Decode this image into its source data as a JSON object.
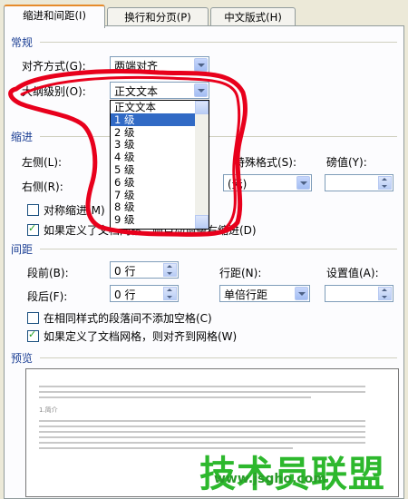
{
  "tabs": [
    {
      "label": "缩进和间距(I)",
      "active": true
    },
    {
      "label": "换行和分页(P)",
      "active": false
    },
    {
      "label": "中文版式(H)",
      "active": false
    }
  ],
  "general": {
    "heading": "常规",
    "alignment_label": "对齐方式(G):",
    "alignment_value": "两端对齐",
    "outline_label": "大纲级别(O):",
    "outline_value": "正文文本"
  },
  "outline_dropdown": {
    "items": [
      "正文文本",
      "1 级",
      "2 级",
      "3 级",
      "4 级",
      "5 级",
      "6 级",
      "7 级",
      "8 级",
      "9 级"
    ],
    "selected_index": 1
  },
  "indent": {
    "heading": "缩进",
    "left_label": "左侧(L):",
    "right_label": "右侧(R):",
    "special_label": "特殊格式(S):",
    "special_value": "(无)",
    "by_label": "磅值(Y):",
    "mirror_label": "对称缩进(M)",
    "auto_adjust_label": "如果定义了文档网格，则自动调整右缩进(D)",
    "auto_adjust_checked": true,
    "mirror_checked": false
  },
  "spacing": {
    "heading": "间距",
    "before_label": "段前(B):",
    "before_value": "0 行",
    "after_label": "段后(F):",
    "after_value": "0 行",
    "line_label": "行距(N):",
    "line_value": "单倍行距",
    "at_label": "设置值(A):",
    "no_space_label": "在相同样式的段落间不添加空格(C)",
    "no_space_checked": false,
    "snap_grid_label": "如果定义了文档网格，则对齐到网格(W)",
    "snap_grid_checked": true
  },
  "preview": {
    "heading": "预览",
    "sample_heading": "1.简介"
  },
  "watermark": {
    "text": "技术员联盟",
    "url": "www.jsgho.com"
  },
  "colors": {
    "section_heading": "#1c3f94",
    "selection": "#316ac5",
    "annotation": "#e8001c",
    "watermark": "#2db82d"
  }
}
